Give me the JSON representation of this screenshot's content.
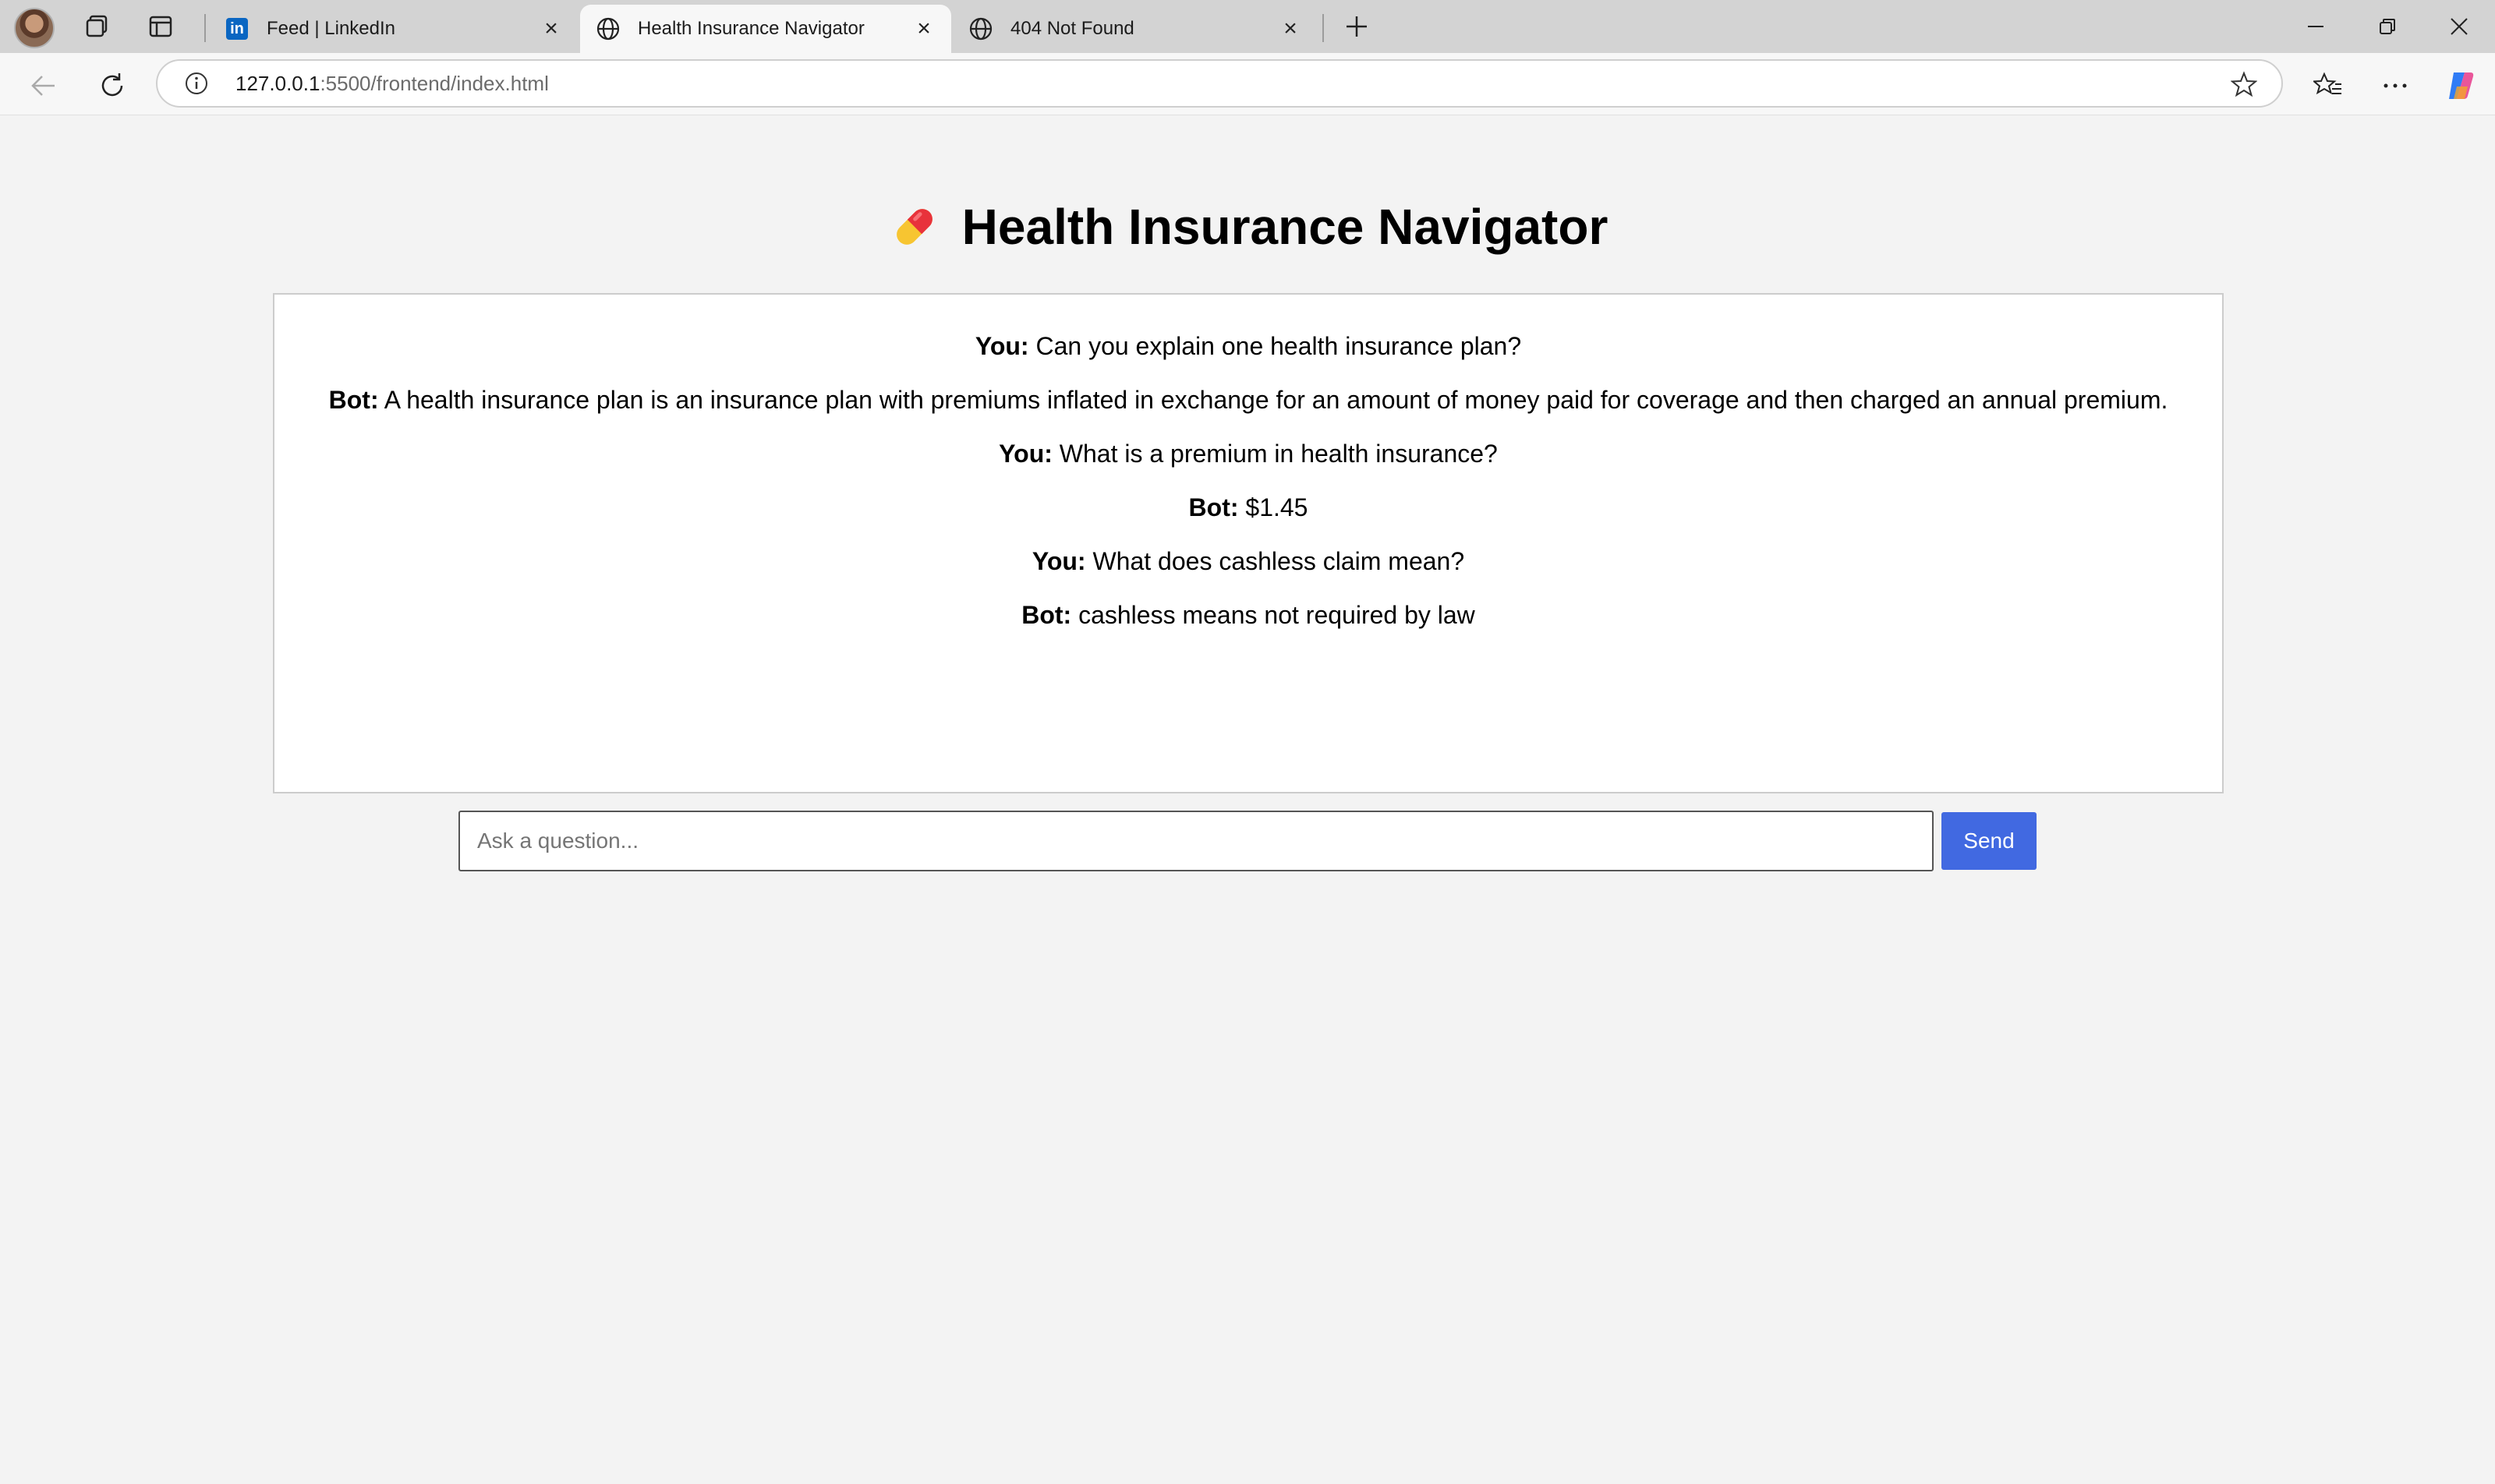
{
  "browser": {
    "tabs": [
      {
        "title": "Feed | LinkedIn",
        "favicon": "linkedin-icon",
        "active": false
      },
      {
        "title": "Health Insurance Navigator",
        "favicon": "globe-icon",
        "active": true
      },
      {
        "title": "404 Not Found",
        "favicon": "globe-icon",
        "active": false
      }
    ],
    "url_host": "127.0.0.1",
    "url_rest": ":5500/frontend/index.html"
  },
  "app": {
    "title": "Health Insurance Navigator",
    "messages": [
      {
        "speaker": "You:",
        "text": "Can you explain one health insurance plan?"
      },
      {
        "speaker": "Bot:",
        "text": "A health insurance plan is an insurance plan with premiums inflated in exchange for an amount of money paid for coverage and then charged an annual premium."
      },
      {
        "speaker": "You:",
        "text": "What is a premium in health insurance?"
      },
      {
        "speaker": "Bot:",
        "text": "$1.45"
      },
      {
        "speaker": "You:",
        "text": "What does cashless claim mean?"
      },
      {
        "speaker": "Bot:",
        "text": "cashless means not required by law"
      }
    ],
    "input_placeholder": "Ask a question...",
    "input_value": "",
    "send_label": "Send"
  },
  "colors": {
    "accent": "#4169e1",
    "page_bg": "#f3f3f3",
    "tabstrip_bg": "#d3d3d3"
  }
}
